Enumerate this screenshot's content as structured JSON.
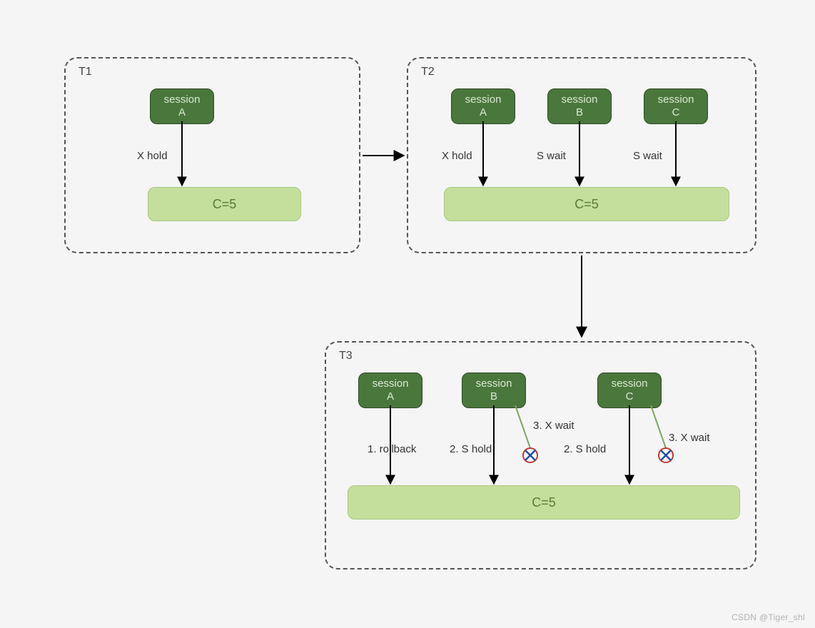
{
  "watermark": "CSDN @Tiger_shl",
  "panels": {
    "t1": {
      "label": "T1",
      "sessions": {
        "a": {
          "line1": "session",
          "line2": "A"
        }
      },
      "arrows": {
        "a": "X hold"
      },
      "data": "C=5"
    },
    "t2": {
      "label": "T2",
      "sessions": {
        "a": {
          "line1": "session",
          "line2": "A"
        },
        "b": {
          "line1": "session",
          "line2": "B"
        },
        "c": {
          "line1": "session",
          "line2": "C"
        }
      },
      "arrows": {
        "a": "X hold",
        "b": "S wait",
        "c": "S wait"
      },
      "data": "C=5"
    },
    "t3": {
      "label": "T3",
      "sessions": {
        "a": {
          "line1": "session",
          "line2": "A"
        },
        "b": {
          "line1": "session",
          "line2": "B"
        },
        "c": {
          "line1": "session",
          "line2": "C"
        }
      },
      "arrows": {
        "a": "1. rollback",
        "b_main": "2. S hold",
        "b_side": "3. X wait",
        "c_main": "2. S hold",
        "c_side": "3. X wait"
      },
      "data": "C=5"
    }
  }
}
